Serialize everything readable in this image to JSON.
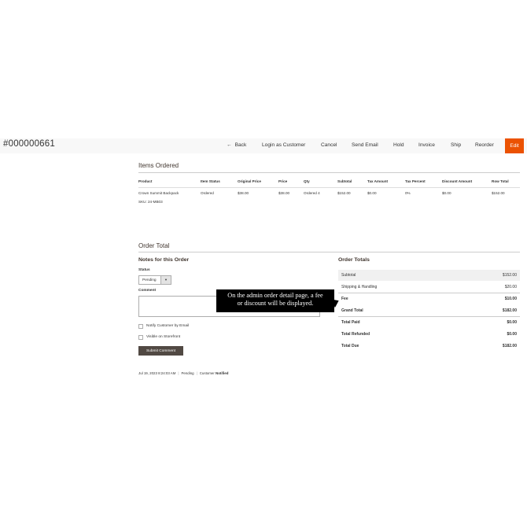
{
  "header": {
    "order_id": "#000000661",
    "buttons": {
      "back": "Back",
      "login_as_customer": "Login as Customer",
      "cancel": "Cancel",
      "send_email": "Send Email",
      "hold": "Hold",
      "invoice": "Invoice",
      "ship": "Ship",
      "reorder": "Reorder",
      "edit": "Edit"
    },
    "accent_color": "#eb5202"
  },
  "items_ordered": {
    "title": "Items Ordered",
    "columns": [
      "Product",
      "Item Status",
      "Original Price",
      "Price",
      "Qty",
      "Subtotal",
      "Tax Amount",
      "Tax Percent",
      "Discount Amount",
      "Row Total"
    ],
    "rows": [
      {
        "product": "Crown Summit Backpack",
        "sku": "SKU: 24-MB03",
        "item_status": "Ordered",
        "original_price": "$38.00",
        "price": "$38.00",
        "qty": "Ordered 4",
        "subtotal": "$152.00",
        "tax_amount": "$0.00",
        "tax_percent": "0%",
        "discount_amount": "$0.00",
        "row_total": "$152.00"
      }
    ]
  },
  "order_total": {
    "title": "Order Total",
    "notes": {
      "title": "Notes for this Order",
      "status_label": "Status",
      "status_value": "Pending",
      "comment_label": "Comment",
      "notify_label": "Notify Customer by Email",
      "visible_label": "Visible on Storefront",
      "submit_label": "Submit Comment"
    },
    "history": {
      "date": "Jul 19, 2023 8:24:03 AM",
      "status": "Pending",
      "customer_label": "Customer",
      "customer_state": "Notified"
    },
    "totals": {
      "title": "Order Totals",
      "subtotal_label": "Subtotal",
      "subtotal": "$152.00",
      "shipping_label": "Shipping & Handling",
      "shipping": "$20.00",
      "fee_label": "Fee",
      "fee": "$10.00",
      "grand_total_label": "Grand Total",
      "grand_total": "$182.00",
      "total_paid_label": "Total Paid",
      "total_paid": "$0.00",
      "total_refunded_label": "Total Refunded",
      "total_refunded": "$0.00",
      "total_due_label": "Total Due",
      "total_due": "$182.00"
    }
  },
  "tooltip": {
    "line1": "On the admin order detail page, a fee",
    "line2": "or discount will be displayed."
  }
}
